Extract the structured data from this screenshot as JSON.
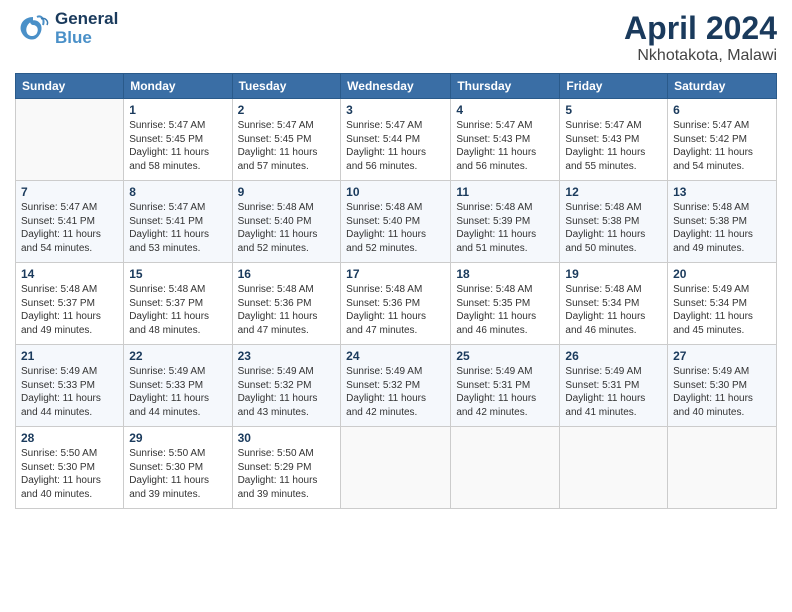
{
  "header": {
    "month": "April 2024",
    "location": "Nkhotakota, Malawi",
    "logo_general": "General",
    "logo_blue": "Blue"
  },
  "days_of_week": [
    "Sunday",
    "Monday",
    "Tuesday",
    "Wednesday",
    "Thursday",
    "Friday",
    "Saturday"
  ],
  "weeks": [
    [
      {
        "day": "",
        "sunrise": "",
        "sunset": "",
        "daylight": ""
      },
      {
        "day": "1",
        "sunrise": "Sunrise: 5:47 AM",
        "sunset": "Sunset: 5:45 PM",
        "daylight": "Daylight: 11 hours and 58 minutes."
      },
      {
        "day": "2",
        "sunrise": "Sunrise: 5:47 AM",
        "sunset": "Sunset: 5:45 PM",
        "daylight": "Daylight: 11 hours and 57 minutes."
      },
      {
        "day": "3",
        "sunrise": "Sunrise: 5:47 AM",
        "sunset": "Sunset: 5:44 PM",
        "daylight": "Daylight: 11 hours and 56 minutes."
      },
      {
        "day": "4",
        "sunrise": "Sunrise: 5:47 AM",
        "sunset": "Sunset: 5:43 PM",
        "daylight": "Daylight: 11 hours and 56 minutes."
      },
      {
        "day": "5",
        "sunrise": "Sunrise: 5:47 AM",
        "sunset": "Sunset: 5:43 PM",
        "daylight": "Daylight: 11 hours and 55 minutes."
      },
      {
        "day": "6",
        "sunrise": "Sunrise: 5:47 AM",
        "sunset": "Sunset: 5:42 PM",
        "daylight": "Daylight: 11 hours and 54 minutes."
      }
    ],
    [
      {
        "day": "7",
        "sunrise": "Sunrise: 5:47 AM",
        "sunset": "Sunset: 5:41 PM",
        "daylight": "Daylight: 11 hours and 54 minutes."
      },
      {
        "day": "8",
        "sunrise": "Sunrise: 5:47 AM",
        "sunset": "Sunset: 5:41 PM",
        "daylight": "Daylight: 11 hours and 53 minutes."
      },
      {
        "day": "9",
        "sunrise": "Sunrise: 5:48 AM",
        "sunset": "Sunset: 5:40 PM",
        "daylight": "Daylight: 11 hours and 52 minutes."
      },
      {
        "day": "10",
        "sunrise": "Sunrise: 5:48 AM",
        "sunset": "Sunset: 5:40 PM",
        "daylight": "Daylight: 11 hours and 52 minutes."
      },
      {
        "day": "11",
        "sunrise": "Sunrise: 5:48 AM",
        "sunset": "Sunset: 5:39 PM",
        "daylight": "Daylight: 11 hours and 51 minutes."
      },
      {
        "day": "12",
        "sunrise": "Sunrise: 5:48 AM",
        "sunset": "Sunset: 5:38 PM",
        "daylight": "Daylight: 11 hours and 50 minutes."
      },
      {
        "day": "13",
        "sunrise": "Sunrise: 5:48 AM",
        "sunset": "Sunset: 5:38 PM",
        "daylight": "Daylight: 11 hours and 49 minutes."
      }
    ],
    [
      {
        "day": "14",
        "sunrise": "Sunrise: 5:48 AM",
        "sunset": "Sunset: 5:37 PM",
        "daylight": "Daylight: 11 hours and 49 minutes."
      },
      {
        "day": "15",
        "sunrise": "Sunrise: 5:48 AM",
        "sunset": "Sunset: 5:37 PM",
        "daylight": "Daylight: 11 hours and 48 minutes."
      },
      {
        "day": "16",
        "sunrise": "Sunrise: 5:48 AM",
        "sunset": "Sunset: 5:36 PM",
        "daylight": "Daylight: 11 hours and 47 minutes."
      },
      {
        "day": "17",
        "sunrise": "Sunrise: 5:48 AM",
        "sunset": "Sunset: 5:36 PM",
        "daylight": "Daylight: 11 hours and 47 minutes."
      },
      {
        "day": "18",
        "sunrise": "Sunrise: 5:48 AM",
        "sunset": "Sunset: 5:35 PM",
        "daylight": "Daylight: 11 hours and 46 minutes."
      },
      {
        "day": "19",
        "sunrise": "Sunrise: 5:48 AM",
        "sunset": "Sunset: 5:34 PM",
        "daylight": "Daylight: 11 hours and 46 minutes."
      },
      {
        "day": "20",
        "sunrise": "Sunrise: 5:49 AM",
        "sunset": "Sunset: 5:34 PM",
        "daylight": "Daylight: 11 hours and 45 minutes."
      }
    ],
    [
      {
        "day": "21",
        "sunrise": "Sunrise: 5:49 AM",
        "sunset": "Sunset: 5:33 PM",
        "daylight": "Daylight: 11 hours and 44 minutes."
      },
      {
        "day": "22",
        "sunrise": "Sunrise: 5:49 AM",
        "sunset": "Sunset: 5:33 PM",
        "daylight": "Daylight: 11 hours and 44 minutes."
      },
      {
        "day": "23",
        "sunrise": "Sunrise: 5:49 AM",
        "sunset": "Sunset: 5:32 PM",
        "daylight": "Daylight: 11 hours and 43 minutes."
      },
      {
        "day": "24",
        "sunrise": "Sunrise: 5:49 AM",
        "sunset": "Sunset: 5:32 PM",
        "daylight": "Daylight: 11 hours and 42 minutes."
      },
      {
        "day": "25",
        "sunrise": "Sunrise: 5:49 AM",
        "sunset": "Sunset: 5:31 PM",
        "daylight": "Daylight: 11 hours and 42 minutes."
      },
      {
        "day": "26",
        "sunrise": "Sunrise: 5:49 AM",
        "sunset": "Sunset: 5:31 PM",
        "daylight": "Daylight: 11 hours and 41 minutes."
      },
      {
        "day": "27",
        "sunrise": "Sunrise: 5:49 AM",
        "sunset": "Sunset: 5:30 PM",
        "daylight": "Daylight: 11 hours and 40 minutes."
      }
    ],
    [
      {
        "day": "28",
        "sunrise": "Sunrise: 5:50 AM",
        "sunset": "Sunset: 5:30 PM",
        "daylight": "Daylight: 11 hours and 40 minutes."
      },
      {
        "day": "29",
        "sunrise": "Sunrise: 5:50 AM",
        "sunset": "Sunset: 5:30 PM",
        "daylight": "Daylight: 11 hours and 39 minutes."
      },
      {
        "day": "30",
        "sunrise": "Sunrise: 5:50 AM",
        "sunset": "Sunset: 5:29 PM",
        "daylight": "Daylight: 11 hours and 39 minutes."
      },
      {
        "day": "",
        "sunrise": "",
        "sunset": "",
        "daylight": ""
      },
      {
        "day": "",
        "sunrise": "",
        "sunset": "",
        "daylight": ""
      },
      {
        "day": "",
        "sunrise": "",
        "sunset": "",
        "daylight": ""
      },
      {
        "day": "",
        "sunrise": "",
        "sunset": "",
        "daylight": ""
      }
    ]
  ]
}
